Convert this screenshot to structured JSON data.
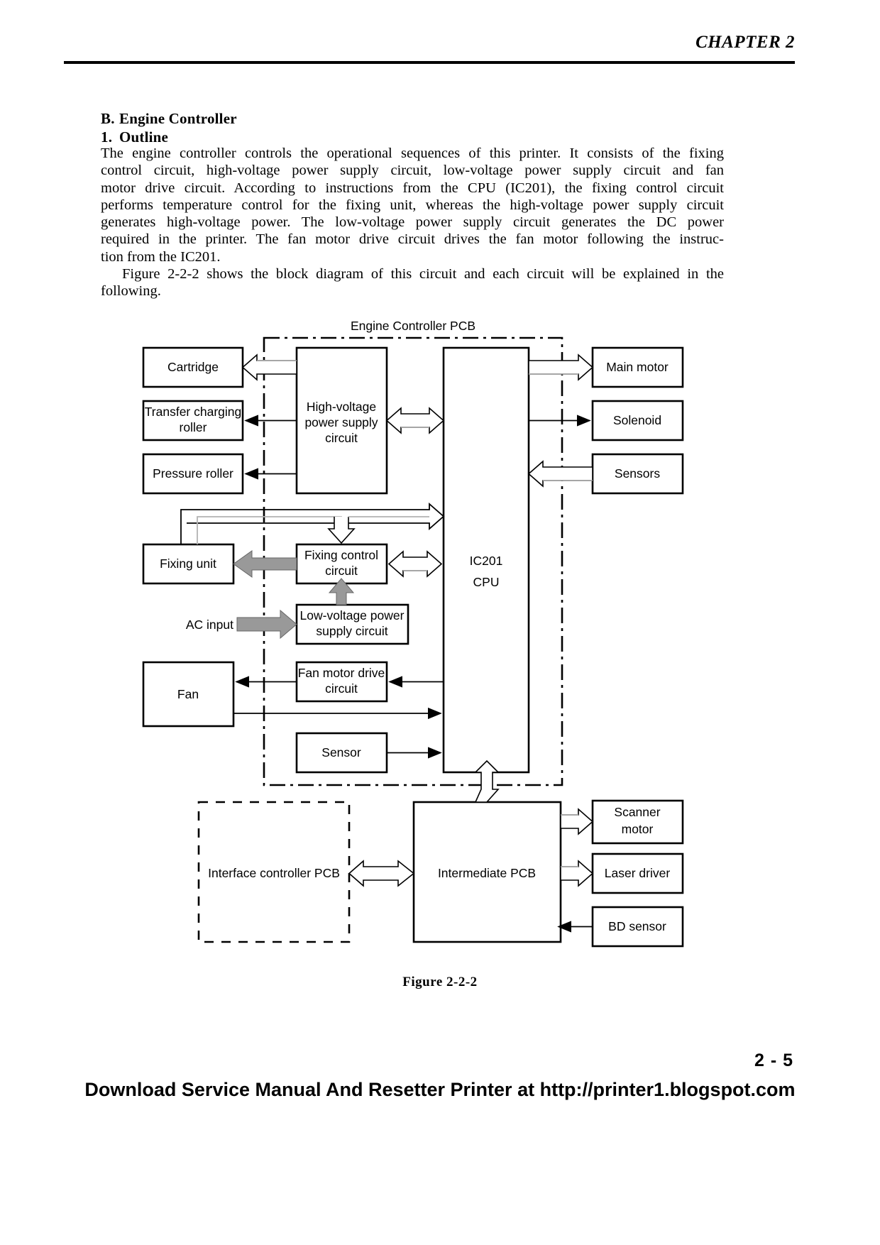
{
  "header": {
    "chapter": "CHAPTER 2"
  },
  "headings": {
    "section_letter": "B.",
    "section_title": "Engine Controller",
    "subsection_number": "1.",
    "subsection_title": "Outline"
  },
  "body": {
    "paragraph1_lines": [
      "The engine controller controls the operational sequences of this printer.  It consists of the fixing",
      "control circuit, high-voltage power supply circuit, low-voltage power supply circuit and fan",
      "motor drive circuit.  According to instructions from the CPU (IC201), the fixing control circuit",
      "performs temperature control for the fixing unit, whereas the high-voltage power supply circuit",
      "generates high-voltage power.  The low-voltage power supply circuit generates the DC power",
      "required in the printer.  The fan motor drive circuit drives the fan motor following the instruc-",
      "tion from the IC201."
    ],
    "paragraph2_lines": [
      "Figure 2-2-2 shows the block diagram of this circuit and each circuit will be explained in the",
      "following."
    ]
  },
  "diagram": {
    "pcb_label": "Engine Controller PCB",
    "interface_pcb_label": "Interface controller PCB",
    "blocks": {
      "cartridge": "Cartridge",
      "transfer_charging_roller_line1": "Transfer charging",
      "transfer_charging_roller_line2": "roller",
      "pressure_roller": "Pressure roller",
      "high_voltage_line1": "High-voltage",
      "high_voltage_line2": "power supply",
      "high_voltage_line3": "circuit",
      "main_motor": "Main motor",
      "solenoid": "Solenoid",
      "sensors": "Sensors",
      "fixing_unit": "Fixing unit",
      "fixing_control_line1": "Fixing control",
      "fixing_control_line2": "circuit",
      "cpu_line1": "IC201",
      "cpu_line2": "CPU",
      "ac_input": "AC input",
      "low_voltage_line1": "Low-voltage power",
      "low_voltage_line2": "supply circuit",
      "fan": "Fan",
      "fan_motor_drive_line1": "Fan motor drive",
      "fan_motor_drive_line2": "circuit",
      "sensor": "Sensor",
      "intermediate_pcb": "Intermediate PCB",
      "scanner_motor_line1": "Scanner",
      "scanner_motor_line2": "motor",
      "laser_driver": "Laser driver",
      "bd_sensor": "BD sensor"
    },
    "colors": {
      "outline": "#000000",
      "power_arrow_fill": "#999999",
      "signal_arrow_fill": "#ffffff",
      "signal_arrow_light_stroke": "#b3b3b3"
    }
  },
  "caption": "Figure 2-2-2",
  "footer": {
    "page_number": "2 - 5",
    "banner": "Download Service Manual And Resetter Printer at http://printer1.blogspot.com"
  }
}
